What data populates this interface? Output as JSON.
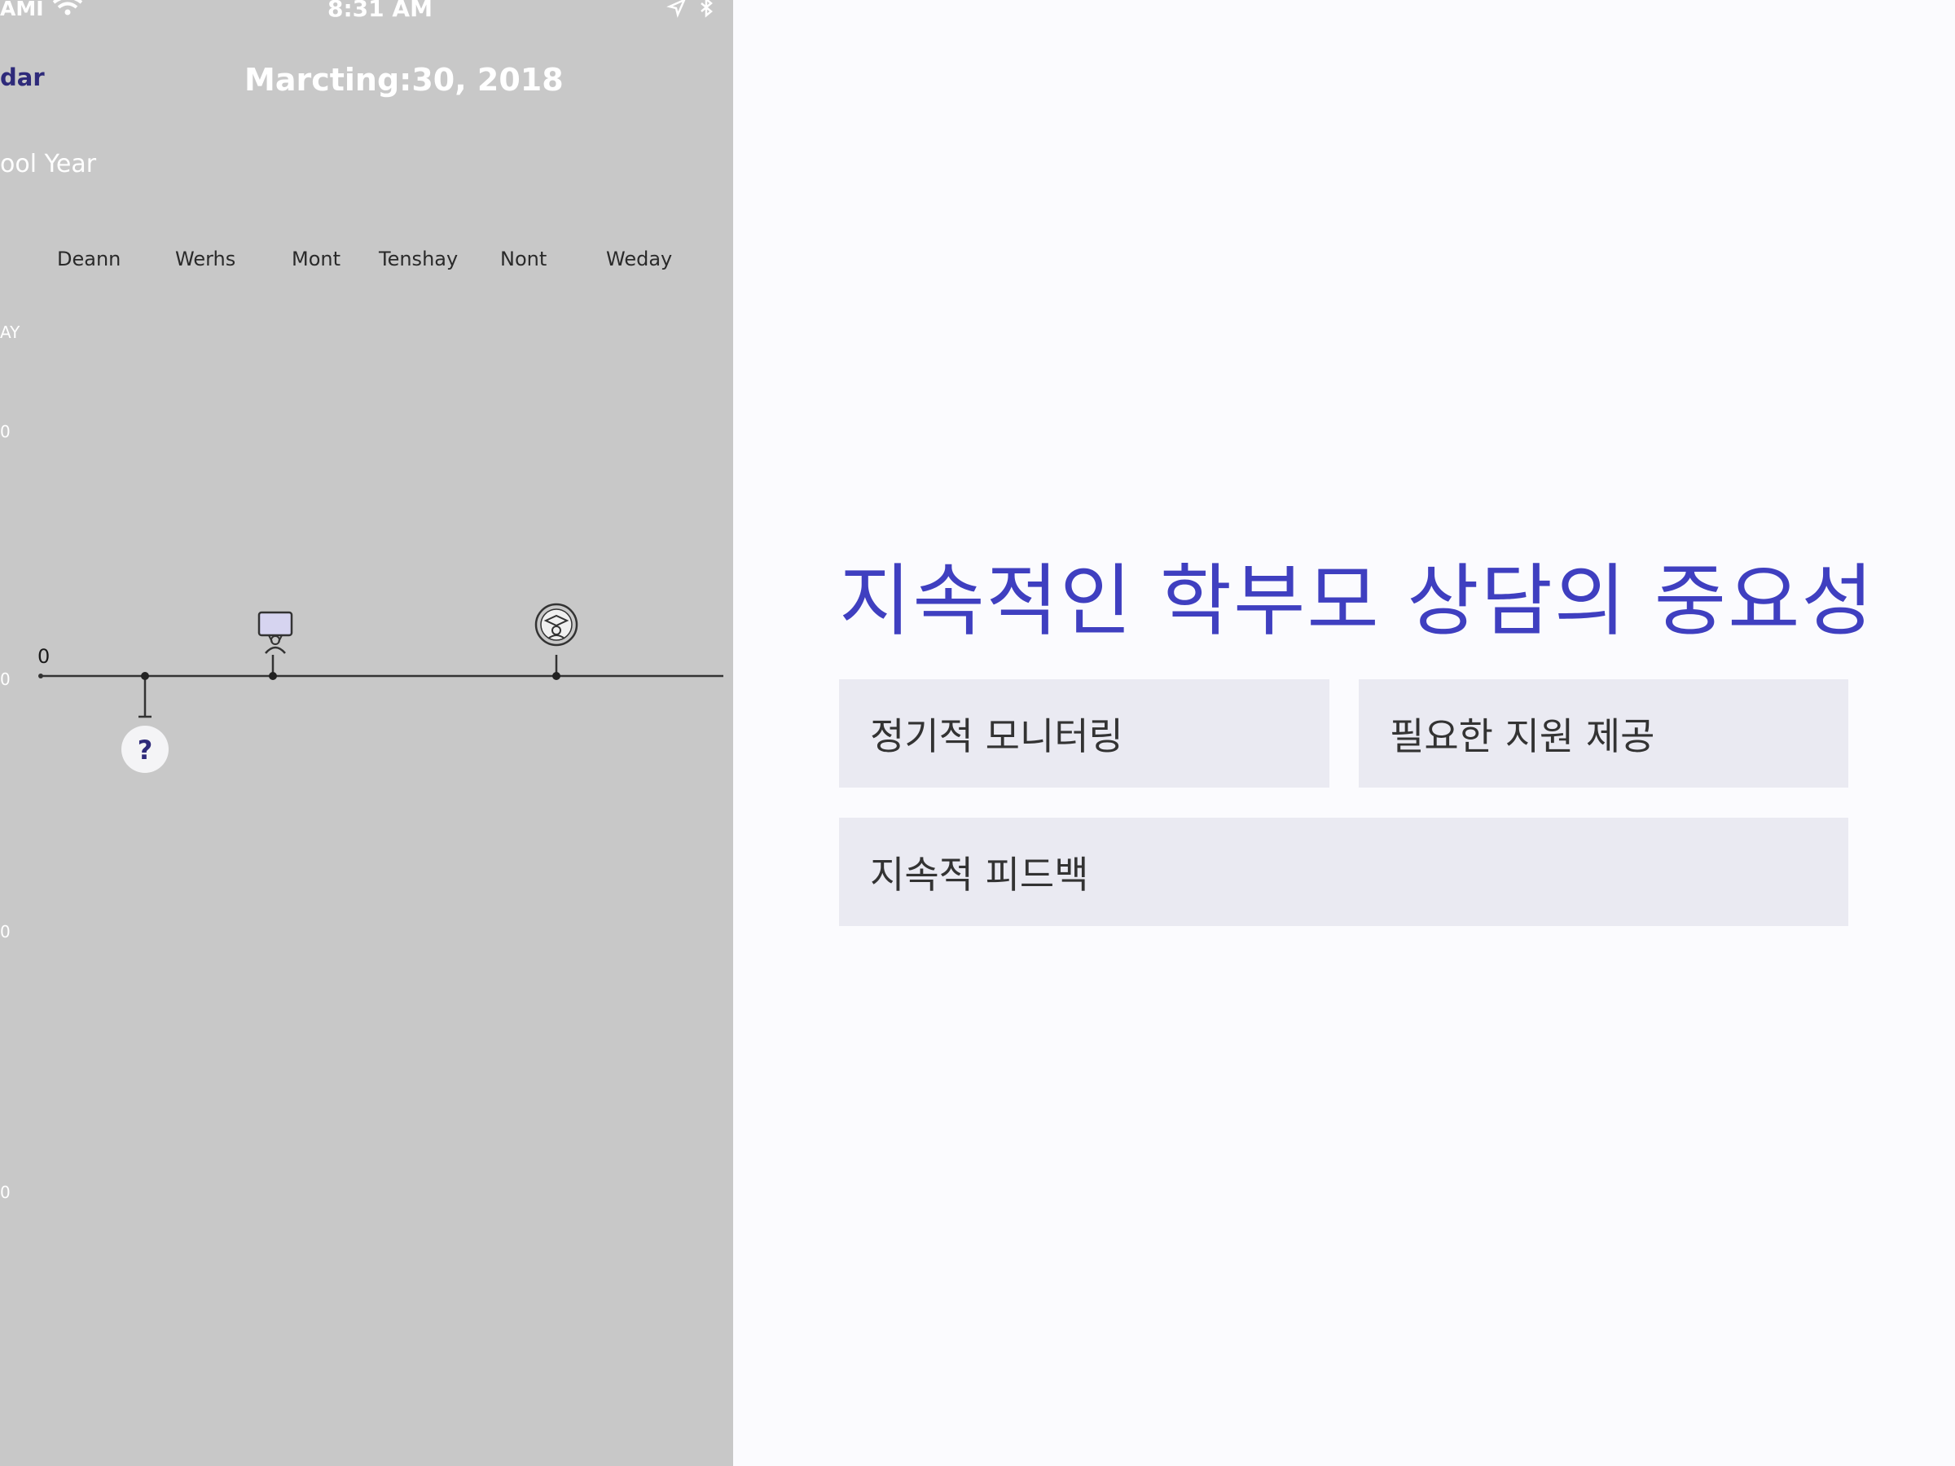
{
  "status_bar": {
    "carrier": "AMI",
    "time": "8:31 AM"
  },
  "nav": {
    "back_label": "dar",
    "title": "Marcting:30, 2018"
  },
  "calendar": {
    "year_label": "ool Year",
    "days": [
      "Deann",
      "Werhs",
      "Mont",
      "Tenshay",
      "Nont",
      "Weday"
    ],
    "side_labels": [
      "AY",
      "0",
      "0",
      "0",
      "0"
    ],
    "axis_zero": "0",
    "help_marker": "?"
  },
  "slide": {
    "title": "지속적인 학부모 상담의 중요성",
    "cards": [
      "정기적 모니터링",
      "필요한 지원 제공",
      "지속적 피드백"
    ],
    "accent_color": "#3f3fc0",
    "card_color": "#eaeaf2"
  }
}
